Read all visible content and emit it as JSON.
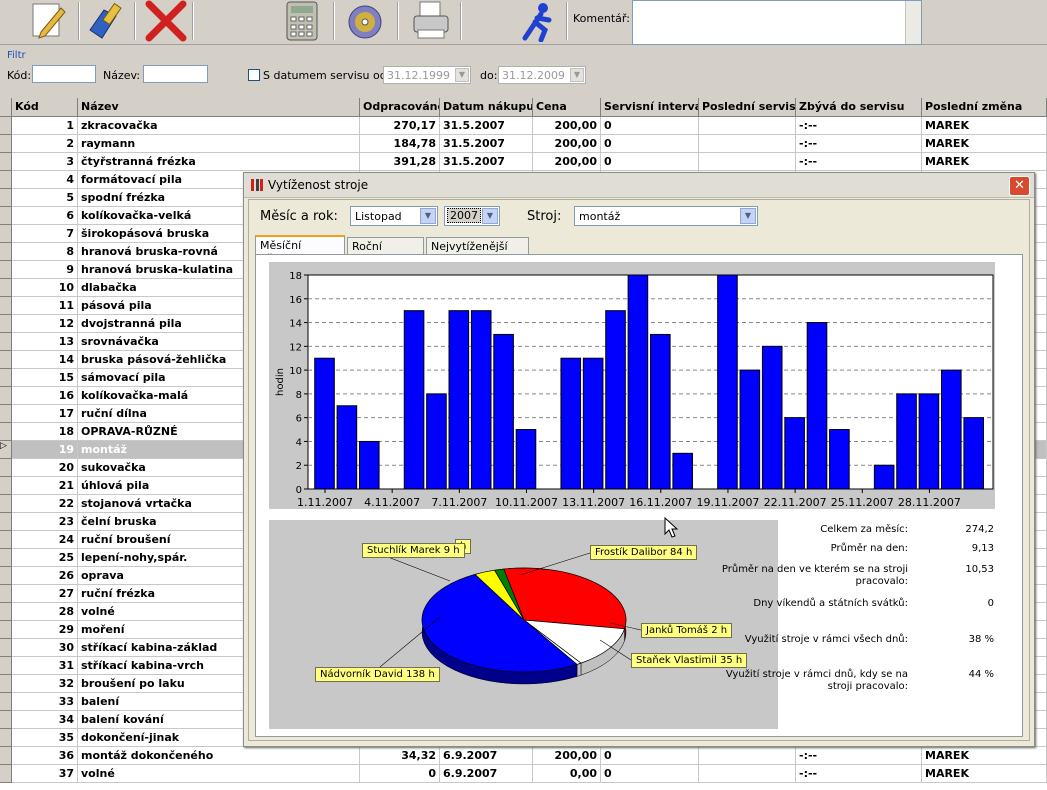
{
  "toolbar": {
    "buttons": [
      {
        "name": "edit-icon",
        "color": "#e8b840"
      },
      {
        "name": "tools-icon",
        "color": "#3060c0"
      },
      {
        "name": "delete-icon",
        "color": "#d02020"
      },
      {
        "name": "calculator-icon",
        "color": "#a0a090"
      },
      {
        "name": "cd-icon",
        "color": "#d0b040"
      },
      {
        "name": "printer-icon",
        "color": "#b0b0b0"
      },
      {
        "name": "run-icon",
        "color": "#2040d0"
      }
    ],
    "comment_label": "Komentář:"
  },
  "filter": {
    "title": "Filtr",
    "kod_label": "Kód:",
    "nazev_label": "Název:",
    "service_date_label": "S datumem servisu od:",
    "date_from": "31.12.1999",
    "to_label": "do:",
    "date_to": "31.12.2009"
  },
  "grid": {
    "columns": [
      "Kód",
      "Název",
      "Odpracováno",
      "Datum nákupu",
      "Cena",
      "Servisní interval",
      "Poslední servis",
      "Zbývá do servisu",
      "Poslední změna"
    ],
    "rows": [
      {
        "kod": "1",
        "nazev": "zkracovačka",
        "odprac": "270,17",
        "datum": "31.5.2007",
        "cena": "200,00",
        "interval": "0",
        "posledni": "",
        "zbyva": "-:--",
        "zmena": "MAREK"
      },
      {
        "kod": "2",
        "nazev": "raymann",
        "odprac": "184,78",
        "datum": "31.5.2007",
        "cena": "200,00",
        "interval": "0",
        "posledni": "",
        "zbyva": "-:--",
        "zmena": "MAREK"
      },
      {
        "kod": "3",
        "nazev": "čtyřstranná frézka",
        "odprac": "391,28",
        "datum": "31.5.2007",
        "cena": "200,00",
        "interval": "0",
        "posledni": "",
        "zbyva": "-:--",
        "zmena": "MAREK"
      },
      {
        "kod": "4",
        "nazev": "formátovací pila"
      },
      {
        "kod": "5",
        "nazev": "spodní frézka"
      },
      {
        "kod": "6",
        "nazev": "kolíkovačka-velká"
      },
      {
        "kod": "7",
        "nazev": "širokopásová bruska"
      },
      {
        "kod": "8",
        "nazev": "hranová bruska-rovná"
      },
      {
        "kod": "9",
        "nazev": "hranová bruska-kulatina"
      },
      {
        "kod": "10",
        "nazev": "dlabačka"
      },
      {
        "kod": "11",
        "nazev": "pásová pila"
      },
      {
        "kod": "12",
        "nazev": "dvojstranná pila"
      },
      {
        "kod": "13",
        "nazev": "srovnávačka"
      },
      {
        "kod": "14",
        "nazev": "bruska pásová-žehlička"
      },
      {
        "kod": "15",
        "nazev": "sámovací pila"
      },
      {
        "kod": "16",
        "nazev": "kolíkovačka-malá"
      },
      {
        "kod": "17",
        "nazev": "ruční dílna"
      },
      {
        "kod": "18",
        "nazev": "OPRAVA-RŮZNÉ"
      },
      {
        "kod": "19",
        "nazev": "montáž",
        "selected": true
      },
      {
        "kod": "20",
        "nazev": "sukovačka"
      },
      {
        "kod": "21",
        "nazev": "úhlová pila"
      },
      {
        "kod": "22",
        "nazev": "stojanová vrtačka"
      },
      {
        "kod": "23",
        "nazev": "čelní bruska"
      },
      {
        "kod": "24",
        "nazev": "ruční broušení"
      },
      {
        "kod": "25",
        "nazev": "lepení-nohy,spár."
      },
      {
        "kod": "26",
        "nazev": "oprava"
      },
      {
        "kod": "27",
        "nazev": "ruční frézka"
      },
      {
        "kod": "28",
        "nazev": "volné"
      },
      {
        "kod": "29",
        "nazev": "moření"
      },
      {
        "kod": "30",
        "nazev": "stříkací kabina-základ"
      },
      {
        "kod": "31",
        "nazev": "stříkací kabina-vrch"
      },
      {
        "kod": "32",
        "nazev": "broušení po laku"
      },
      {
        "kod": "33",
        "nazev": "balení"
      },
      {
        "kod": "34",
        "nazev": "balení kování"
      },
      {
        "kod": "35",
        "nazev": "dokončení-jinak"
      },
      {
        "kod": "36",
        "nazev": "montáž dokončeného",
        "odprac": "34,32",
        "datum": "6.9.2007",
        "cena": "200,00",
        "interval": "0",
        "posledni": "",
        "zbyva": "-:--",
        "zmena": "MAREK"
      },
      {
        "kod": "37",
        "nazev": "volné",
        "odprac": "0",
        "datum": "6.9.2007",
        "cena": "0,00",
        "interval": "0",
        "posledni": "",
        "zbyva": "-:--",
        "zmena": "MAREK"
      }
    ]
  },
  "dialog": {
    "title": "Vytíženost stroje",
    "month_year_label": "Měsíc a rok:",
    "month": "Listopad",
    "year": "2007",
    "machine_label": "Stroj:",
    "machine": "montáž",
    "tabs": [
      "Měsíční přehled",
      "Roční přehled",
      "Nejvytíženější stroje"
    ],
    "stats": [
      {
        "label": "Celkem za měsíc:",
        "value": "274,2"
      },
      {
        "label": "Průměr na den:",
        "value": "9,13"
      },
      {
        "label": "Průměr na den ve kterém se na stroji pracovalo:",
        "value": "10,53"
      },
      {
        "label": "Dny víkendů a státních svátků:",
        "value": "0"
      },
      {
        "label": "Využití stroje v rámci všech dnů:",
        "value": "38 %"
      },
      {
        "label": "Využití stroje v rámci dnů, kdy se na stroji pracovalo:",
        "value": "44 %"
      }
    ]
  },
  "chart_data": [
    {
      "type": "bar",
      "ylabel": "hodin",
      "ylim": [
        0,
        18
      ],
      "yticks": [
        0,
        2,
        4,
        6,
        8,
        10,
        12,
        14,
        16,
        18
      ],
      "x_tick_labels": [
        "1.11.2007",
        "4.11.2007",
        "7.11.2007",
        "10.11.2007",
        "13.11.2007",
        "16.11.2007",
        "19.11.2007",
        "22.11.2007",
        "25.11.2007",
        "28.11.2007"
      ],
      "values": [
        11,
        7,
        4,
        0,
        15,
        8,
        15,
        15,
        13,
        5,
        0,
        11,
        11,
        15,
        18,
        13,
        3,
        0,
        18,
        10,
        12,
        6,
        14,
        5,
        0,
        2,
        8,
        8,
        10,
        6
      ],
      "grid": true,
      "bar_color": "#0000ff"
    },
    {
      "type": "pie",
      "slices": [
        {
          "label": "Nádvorník David 138 h",
          "value": 138,
          "color": "#0000ff"
        },
        {
          "label": "Stuchlík Marek 9 h",
          "value": 9,
          "color": "#ffff00"
        },
        {
          "label": "h",
          "value": 4,
          "color": "#008000"
        },
        {
          "label": "Frostík Dalibor 84 h",
          "value": 84,
          "color": "#ff0000"
        },
        {
          "label": "Janků Tomáš 2 h",
          "value": 2,
          "color": "#ffffff"
        },
        {
          "label": "Staňek Vlastimil 35 h",
          "value": 35,
          "color": "#ffffff"
        }
      ]
    }
  ]
}
